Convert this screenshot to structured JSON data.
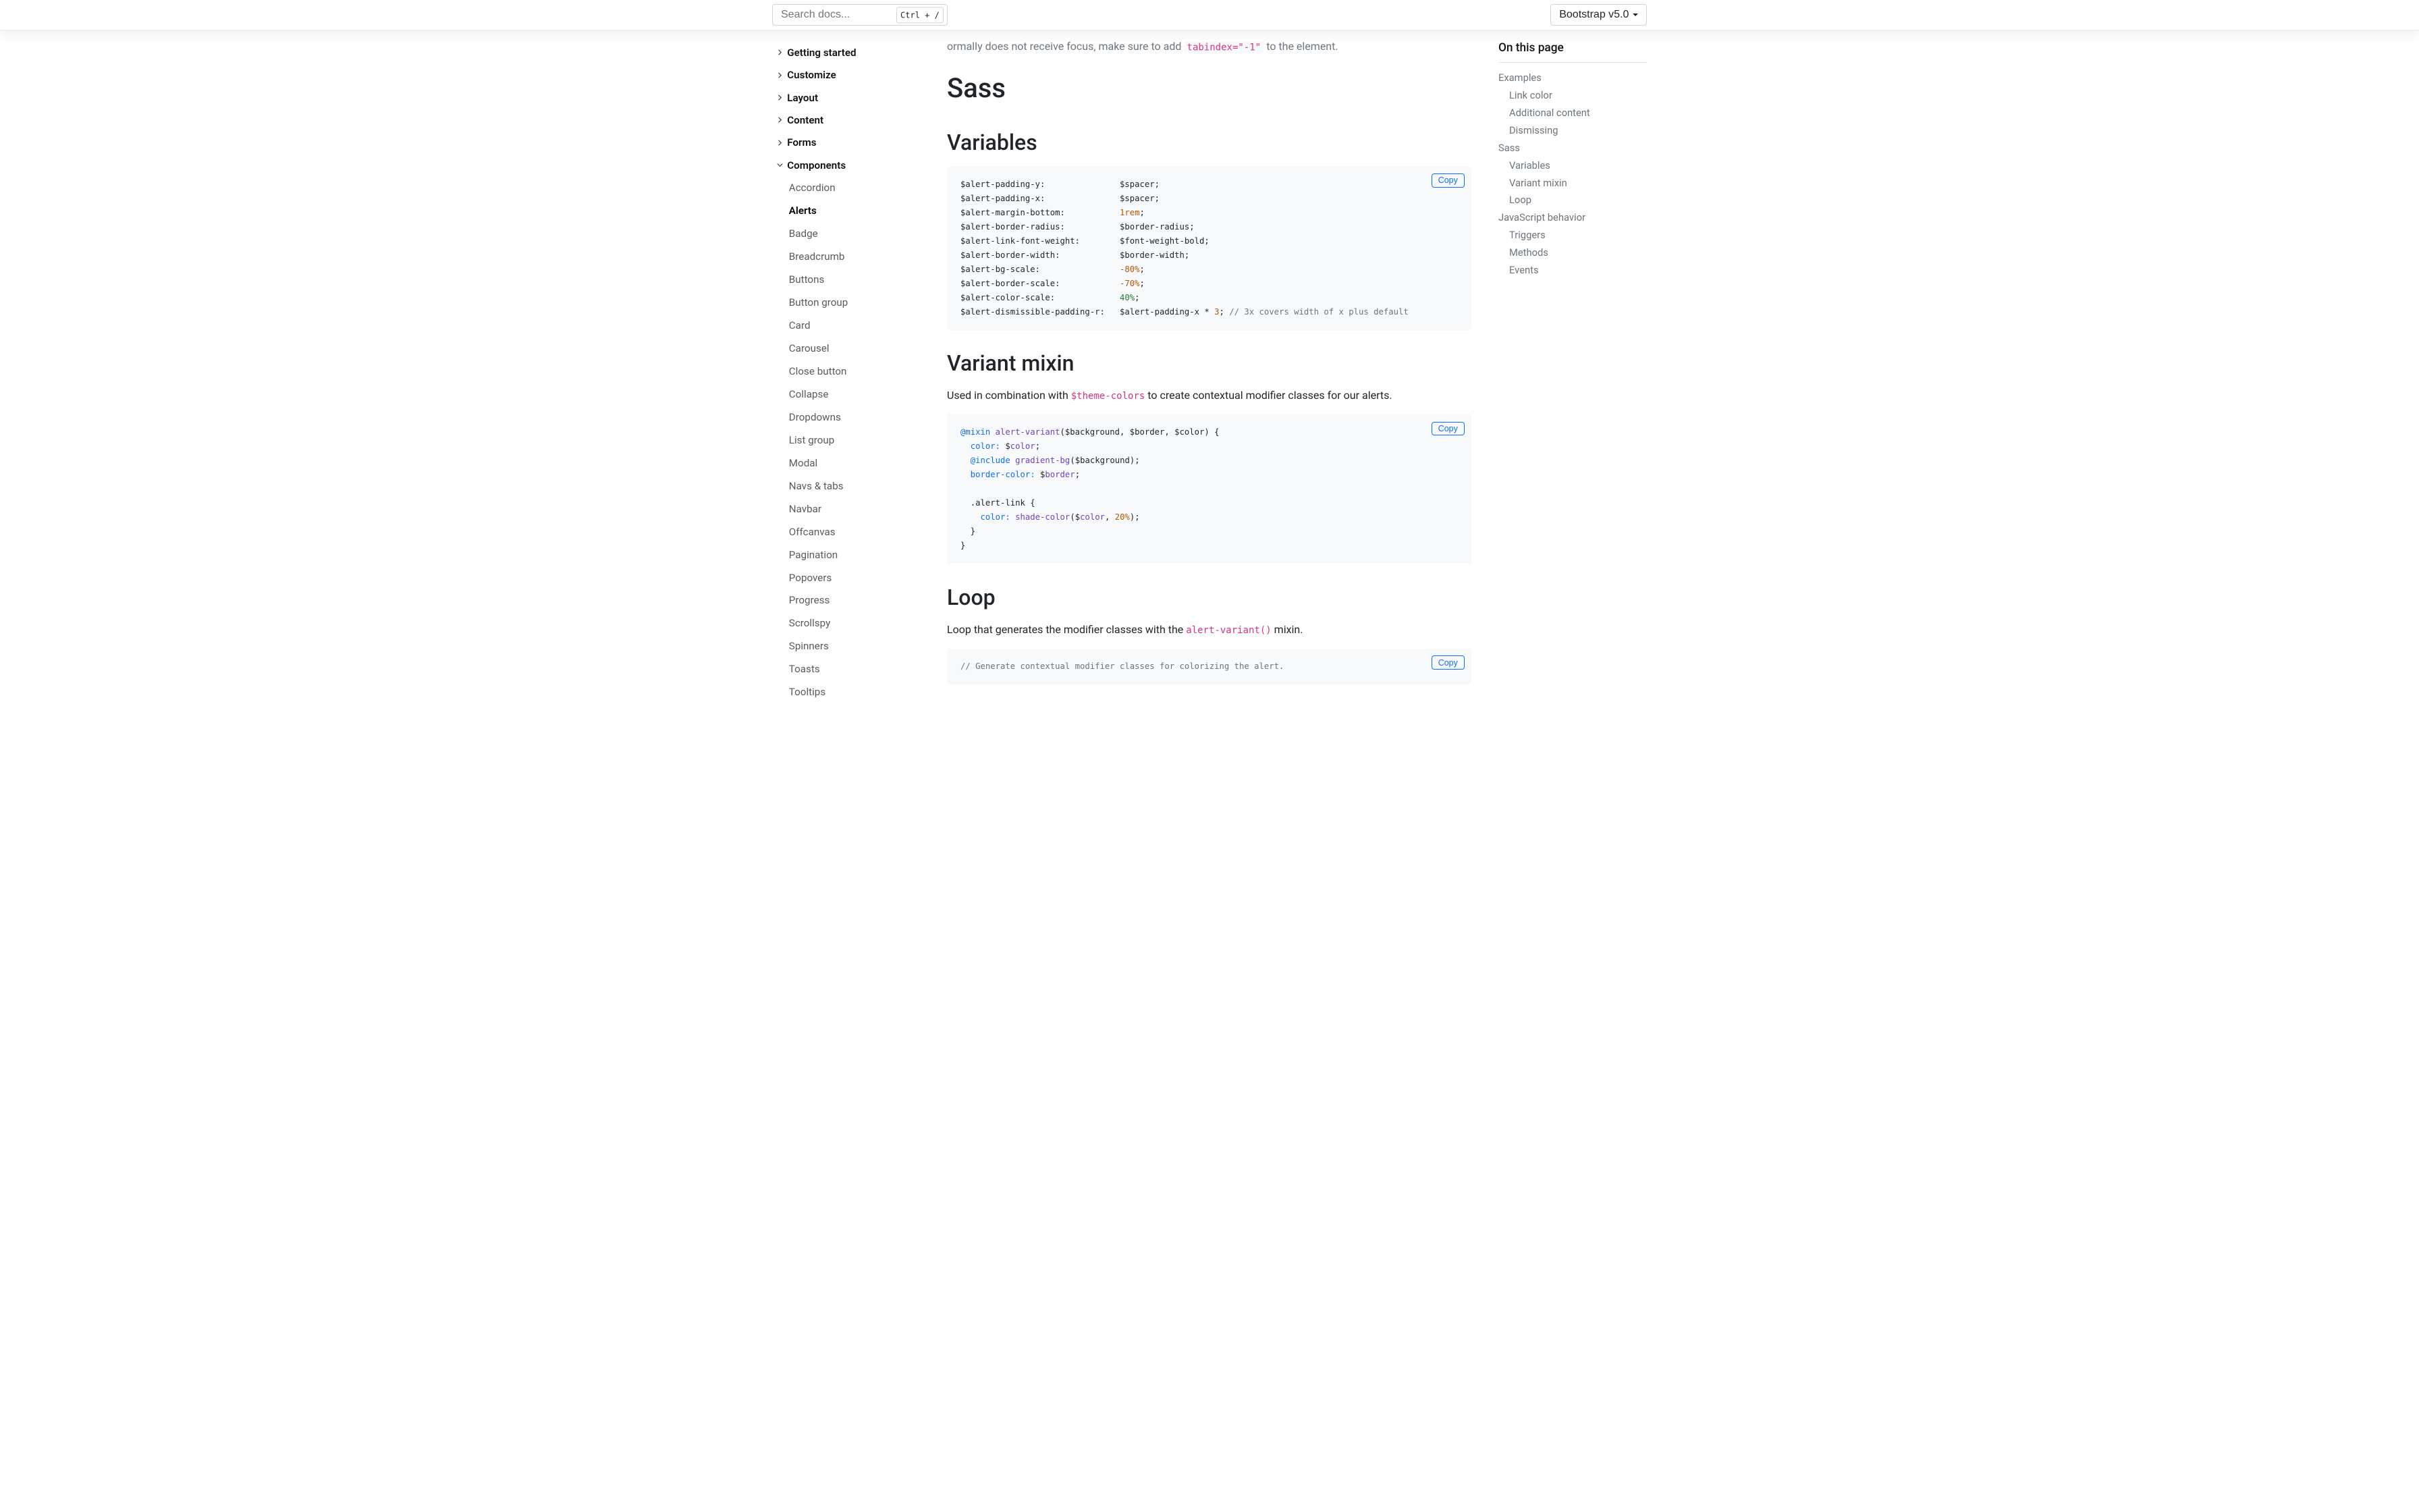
{
  "topbar": {
    "search_placeholder": "Search docs...",
    "search_shortcut": "Ctrl + /",
    "version_label": "Bootstrap v5.0"
  },
  "partial_top": {
    "lead": "ormally does not receive focus, make sure to add",
    "code": "tabindex=\"-1\"",
    "tail": "to the element."
  },
  "sidebar": {
    "groups": [
      {
        "label": "Getting started",
        "expanded": false
      },
      {
        "label": "Customize",
        "expanded": false
      },
      {
        "label": "Layout",
        "expanded": false
      },
      {
        "label": "Content",
        "expanded": false
      },
      {
        "label": "Forms",
        "expanded": false
      },
      {
        "label": "Components",
        "expanded": true
      }
    ],
    "components": [
      "Accordion",
      "Alerts",
      "Badge",
      "Breadcrumb",
      "Buttons",
      "Button group",
      "Card",
      "Carousel",
      "Close button",
      "Collapse",
      "Dropdowns",
      "List group",
      "Modal",
      "Navs & tabs",
      "Navbar",
      "Offcanvas",
      "Pagination",
      "Popovers",
      "Progress",
      "Scrollspy",
      "Spinners",
      "Toasts",
      "Tooltips"
    ],
    "active_component": "Alerts"
  },
  "content": {
    "h1_sass": "Sass",
    "h2_variables": "Variables",
    "copy_label": "Copy",
    "variables_code_html": "<span class='cmt'></span>$alert-padding-y:               $spacer;\n$alert-padding-x:               $spacer;\n$alert-margin-bottom:           <span class='num'>1</span><span class='num'>rem</span>;\n$alert-border-radius:           $border-radius;\n$alert-link-font-weight:        $font-weight-bold;\n$alert-border-width:            $border-width;\n$alert-bg-scale:                <span class='num'>-80%</span>;\n$alert-border-scale:            <span class='num'>-70%</span>;\n$alert-color-scale:             <span class='n'>40%</span>;\n$alert-dismissible-padding-r:   $alert-padding-x * <span class='num'>3</span>; <span class='cmt'>// 3x covers width of x plus default</span>",
    "h2_variant_mixin": "Variant mixin",
    "variant_intro_pre": "Used in combination with ",
    "variant_intro_code": "$theme-colors",
    "variant_intro_post": " to create contextual modifier classes for our alerts.",
    "variant_code_html": "<span class='k'>@mixin</span> <span class='fn'>alert-variant</span>($background, $border, $color) {\n  <span class='k'>color:</span> $<span class='fn'>color</span>;\n  <span class='k'>@include</span> <span class='fn'>gradient-bg</span>($background);\n  <span class='k'>border-color:</span> $<span class='fn'>border</span>;\n\n  .alert-link {\n    <span class='k'>color:</span> <span class='fn'>shade-color</span>($<span class='fn'>color</span>, <span class='num'>20%</span>);\n  }\n}",
    "h2_loop": "Loop",
    "loop_intro_pre": "Loop that generates the modifier classes with the ",
    "loop_intro_code": "alert-variant()",
    "loop_intro_post": " mixin.",
    "loop_code_html": "<span class='cmt'>// Generate contextual modifier classes for colorizing the alert.</span>"
  },
  "toc": {
    "heading": "On this page",
    "items": [
      {
        "label": "Examples",
        "level": 1
      },
      {
        "label": "Link color",
        "level": 2
      },
      {
        "label": "Additional content",
        "level": 2
      },
      {
        "label": "Dismissing",
        "level": 2
      },
      {
        "label": "Sass",
        "level": 1
      },
      {
        "label": "Variables",
        "level": 2
      },
      {
        "label": "Variant mixin",
        "level": 2
      },
      {
        "label": "Loop",
        "level": 2
      },
      {
        "label": "JavaScript behavior",
        "level": 1
      },
      {
        "label": "Triggers",
        "level": 2
      },
      {
        "label": "Methods",
        "level": 2
      },
      {
        "label": "Events",
        "level": 2
      }
    ]
  }
}
